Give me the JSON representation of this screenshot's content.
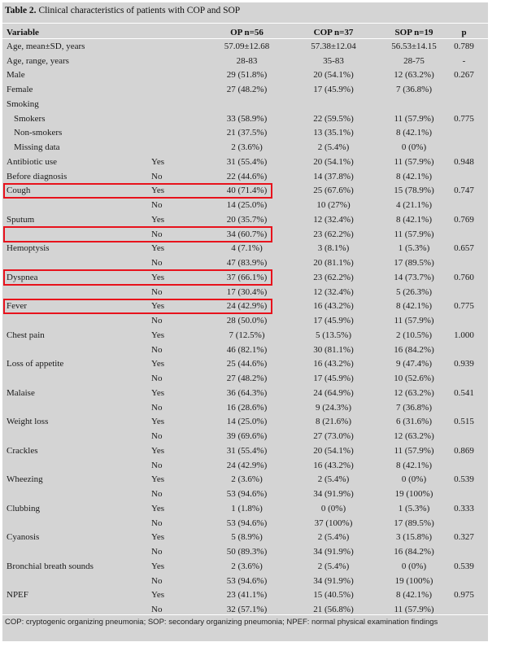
{
  "table": {
    "number": "Table 2.",
    "caption": "Clinical characteristics of patients with COP and SOP",
    "headers": {
      "variable": "Variable",
      "op": "OP n=56",
      "cop": "COP n=37",
      "sop": "SOP n=19",
      "p": "p"
    },
    "rows": [
      {
        "var": "Age, mean±SD, years",
        "sub": "",
        "op": "57.09±12.68",
        "cop": "57.38±12.04",
        "sop": "56.53±14.15",
        "p": "0.789"
      },
      {
        "var": "Age, range, years",
        "sub": "",
        "op": "28-83",
        "cop": "35-83",
        "sop": "28-75",
        "p": "-"
      },
      {
        "var": "Male",
        "sub": "",
        "op": "29 (51.8%)",
        "cop": "20 (54.1%)",
        "sop": "12 (63.2%)",
        "p": "0.267"
      },
      {
        "var": "Female",
        "sub": "",
        "op": "27 (48.2%)",
        "cop": "17 (45.9%)",
        "sop": "7 (36.8%)",
        "p": ""
      },
      {
        "var": "Smoking",
        "sub": "",
        "op": "",
        "cop": "",
        "sop": "",
        "p": ""
      },
      {
        "var": "Smokers",
        "sub": "",
        "op": "33 (58.9%)",
        "cop": "22 (59.5%)",
        "sop": "11 (57.9%)",
        "p": "0.775",
        "indent": true
      },
      {
        "var": "Non-smokers",
        "sub": "",
        "op": "21 (37.5%)",
        "cop": "13 (35.1%)",
        "sop": "8 (42.1%)",
        "p": "",
        "indent": true
      },
      {
        "var": "Missing data",
        "sub": "",
        "op": "2 (3.6%)",
        "cop": "2 (5.4%)",
        "sop": "0 (0%)",
        "p": "",
        "indent": true
      },
      {
        "var": "Antibiotic use",
        "sub": "Yes",
        "op": "31 (55.4%)",
        "cop": "20 (54.1%)",
        "sop": "11 (57.9%)",
        "p": "0.948"
      },
      {
        "var": "Before diagnosis",
        "sub": "No",
        "op": "22 (44.6%)",
        "cop": "14 (37.8%)",
        "sop": "8 (42.1%)",
        "p": ""
      },
      {
        "var": "Cough",
        "sub": "Yes",
        "op": "40 (71.4%)",
        "cop": "25 (67.6%)",
        "sop": "15 (78.9%)",
        "p": "0.747"
      },
      {
        "var": "",
        "sub": "No",
        "op": "14 (25.0%)",
        "cop": "10 (27%)",
        "sop": "4 (21.1%)",
        "p": ""
      },
      {
        "var": "Sputum",
        "sub": "Yes",
        "op": "20 (35.7%)",
        "cop": "12 (32.4%)",
        "sop": "8 (42.1%)",
        "p": "0.769"
      },
      {
        "var": "",
        "sub": "No",
        "op": "34 (60.7%)",
        "cop": "23 (62.2%)",
        "sop": "11 (57.9%)",
        "p": ""
      },
      {
        "var": "Hemoptysis",
        "sub": "Yes",
        "op": "4 (7.1%)",
        "cop": "3 (8.1%)",
        "sop": "1 (5.3%)",
        "p": "0.657"
      },
      {
        "var": "",
        "sub": "No",
        "op": "47 (83.9%)",
        "cop": "20 (81.1%)",
        "sop": "17 (89.5%)",
        "p": ""
      },
      {
        "var": "Dyspnea",
        "sub": "Yes",
        "op": "37 (66.1%)",
        "cop": "23 (62.2%)",
        "sop": "14 (73.7%)",
        "p": "0.760"
      },
      {
        "var": "",
        "sub": "No",
        "op": "17 (30.4%)",
        "cop": "12 (32.4%)",
        "sop": "5 (26.3%)",
        "p": ""
      },
      {
        "var": "Fever",
        "sub": "Yes",
        "op": "24 (42.9%)",
        "cop": "16 (43.2%)",
        "sop": "8 (42.1%)",
        "p": "0.775"
      },
      {
        "var": "",
        "sub": "No",
        "op": "28 (50.0%)",
        "cop": "17 (45.9%)",
        "sop": "11 (57.9%)",
        "p": ""
      },
      {
        "var": "Chest pain",
        "sub": "Yes",
        "op": "7 (12.5%)",
        "cop": "5 (13.5%)",
        "sop": "2 (10.5%)",
        "p": "1.000"
      },
      {
        "var": "",
        "sub": "No",
        "op": "46 (82.1%)",
        "cop": "30 (81.1%)",
        "sop": "16 (84.2%)",
        "p": ""
      },
      {
        "var": "Loss of appetite",
        "sub": "Yes",
        "op": "25 (44.6%)",
        "cop": "16 (43.2%)",
        "sop": "9 (47.4%)",
        "p": "0.939"
      },
      {
        "var": "",
        "sub": "No",
        "op": "27 (48.2%)",
        "cop": "17 (45.9%)",
        "sop": "10 (52.6%)",
        "p": ""
      },
      {
        "var": "Malaise",
        "sub": "Yes",
        "op": "36 (64.3%)",
        "cop": "24 (64.9%)",
        "sop": "12 (63.2%)",
        "p": "0.541"
      },
      {
        "var": "",
        "sub": "No",
        "op": "16 (28.6%)",
        "cop": "9 (24.3%)",
        "sop": "7 (36.8%)",
        "p": ""
      },
      {
        "var": "Weight loss",
        "sub": "Yes",
        "op": "14 (25.0%)",
        "cop": "8 (21.6%)",
        "sop": "6 (31.6%)",
        "p": "0.515"
      },
      {
        "var": "",
        "sub": "No",
        "op": "39 (69.6%)",
        "cop": "27 (73.0%)",
        "sop": "12 (63.2%)",
        "p": ""
      },
      {
        "var": "Crackles",
        "sub": "Yes",
        "op": "31 (55.4%)",
        "cop": "20 (54.1%)",
        "sop": "11 (57.9%)",
        "p": "0.869"
      },
      {
        "var": "",
        "sub": "No",
        "op": "24 (42.9%)",
        "cop": "16 (43.2%)",
        "sop": "8 (42.1%)",
        "p": ""
      },
      {
        "var": "Wheezing",
        "sub": "Yes",
        "op": "2 (3.6%)",
        "cop": "2 (5.4%)",
        "sop": "0 (0%)",
        "p": "0.539"
      },
      {
        "var": "",
        "sub": "No",
        "op": "53 (94.6%)",
        "cop": "34 (91.9%)",
        "sop": "19 (100%)",
        "p": ""
      },
      {
        "var": "Clubbing",
        "sub": "Yes",
        "op": "1 (1.8%)",
        "cop": "0 (0%)",
        "sop": "1 (5.3%)",
        "p": "0.333"
      },
      {
        "var": "",
        "sub": "No",
        "op": "53 (94.6%)",
        "cop": "37 (100%)",
        "sop": "17 (89.5%)",
        "p": ""
      },
      {
        "var": "Cyanosis",
        "sub": "Yes",
        "op": "5 (8.9%)",
        "cop": "2 (5.4%)",
        "sop": "3 (15.8%)",
        "p": "0.327"
      },
      {
        "var": "",
        "sub": "No",
        "op": "50 (89.3%)",
        "cop": "34 (91.9%)",
        "sop": "16 (84.2%)",
        "p": ""
      },
      {
        "var": "Bronchial breath sounds",
        "sub": "Yes",
        "op": "2 (3.6%)",
        "cop": "2 (5.4%)",
        "sop": "0 (0%)",
        "p": "0.539"
      },
      {
        "var": "",
        "sub": "No",
        "op": "53 (94.6%)",
        "cop": "34 (91.9%)",
        "sop": "19 (100%)",
        "p": ""
      },
      {
        "var": "NPEF",
        "sub": "Yes",
        "op": "23 (41.1%)",
        "cop": "15 (40.5%)",
        "sop": "8 (42.1%)",
        "p": "0.975"
      },
      {
        "var": "",
        "sub": "No",
        "op": "32 (57.1%)",
        "cop": "21 (56.8%)",
        "sop": "11 (57.9%)",
        "p": ""
      }
    ],
    "highlighted_rows": [
      10,
      13,
      16,
      18
    ],
    "highlight_color": "#e8121c",
    "background_color": "#d4d4d4",
    "footnote": "COP: cryptogenic organizing pneumonia; SOP: secondary organizing pneumonia; NPEF: normal physical examination findings"
  }
}
